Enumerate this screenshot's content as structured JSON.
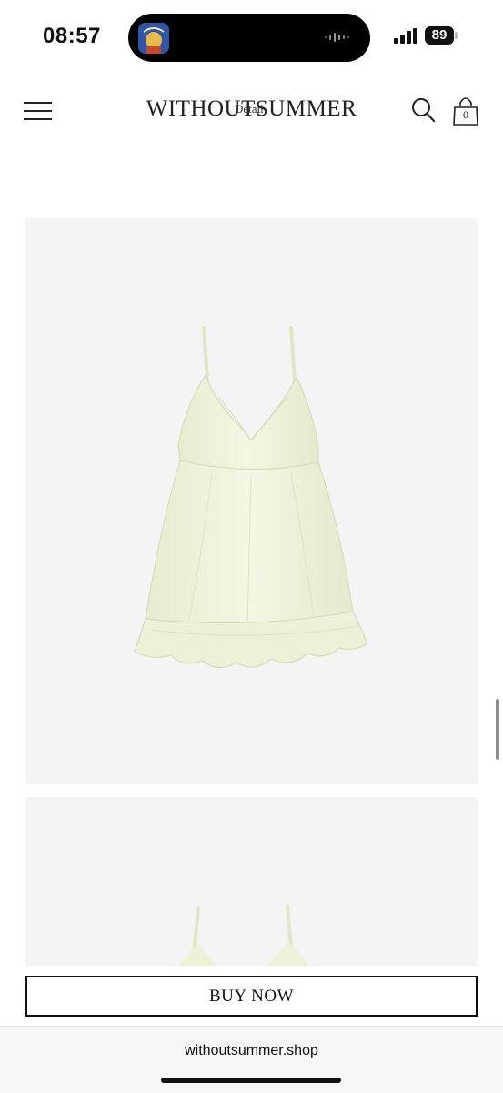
{
  "status_bar": {
    "time": "08:57",
    "battery": "89"
  },
  "header": {
    "logo": "WITHOUTSUMMER",
    "page_label": "Detail",
    "cart_count": "0",
    "icons": [
      "menu-icon",
      "search-icon",
      "shopping-bag-icon"
    ]
  },
  "product": {
    "image_bg": "#f4f4f4",
    "dress_color": "#f1f3dc",
    "buy_label": "BUY NOW"
  },
  "browser": {
    "url": "withoutsummer.shop"
  }
}
